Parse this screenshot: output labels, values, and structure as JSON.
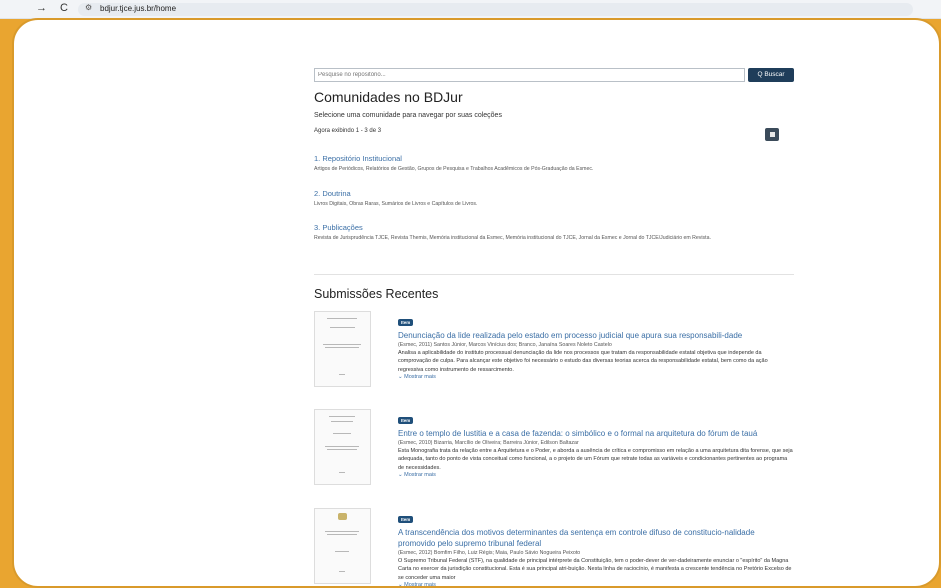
{
  "browser": {
    "url": "bdjur.tjce.jus.br/home",
    "back": "→",
    "reload": "C",
    "tune": "⚙"
  },
  "search": {
    "placeholder": "Pesquise no repositório...",
    "button": "Q Buscar"
  },
  "title": "Comunidades no BDJur",
  "subtitle": "Selecione uma comunidade para navegar por suas coleções",
  "showing": "Agora exibindo 1 - 3 de 3",
  "communities": [
    {
      "title": "1. Repositório Institucional",
      "desc": "Artigos de Periódicos, Relatórios de Gestão, Grupos de Pesquisa e Trabalhos Acadêmicos de Pós-Graduação da Esmec."
    },
    {
      "title": "2. Doutrina",
      "desc": "Livros Digitais, Obras Raras, Sumários de Livros e Capítulos de Livros."
    },
    {
      "title": "3. Publicações",
      "desc": "Revista de Jurisprudência TJCE, Revista Themis, Memória institucional da Esmec, Memória institucional do TJCE, Jornal da Esmec e Jornal do TJCE/Judiciário em Revista."
    }
  ],
  "recent_title": "Submissões Recentes",
  "items": [
    {
      "badge": "Item",
      "title": "Denunciação da lide realizada pelo estado em processo judicial que apura sua responsabili-dade",
      "authors": "(Esmec, 2011) Santos Júnior, Marcos Vinícius dos; Branco, Janaína Soares Noleto Castelo",
      "abstract": "Analisa a aplicabilidade do instituto processual denunciação da lide nos processos que tratam da responsabilidade estatal objetiva que independe da comprovação de culpa. Para alcançar este objetivo foi necessário o estudo das diversas teorias acerca da responsabilidade estatal, bem como da ação regressiva como instrumento de ressarcimento.",
      "more": "⌄ Mostrar mais"
    },
    {
      "badge": "Item",
      "title": "Entre o templo de Iustitia e a casa de fazenda: o simbólico e o formal na arquitetura do fórum de tauá",
      "authors": "(Esmec, 2010) Bizarria, Marcílio de Oliveira; Barreira Júnior, Edilson Baltazar",
      "abstract": "Esta Monografia trata da relação entre a Arquitetura e o Poder, e aborda a ausência de crítica e compromisso em relação a uma arquitetura dita forense, que seja adequada, tanto do ponto de vista conceitual como funcional, a o projeto de um Fórum que retrate todas as variáveis e condicionantes pertinentes ao programa de necessidades.",
      "more": "⌄ Mostrar mais"
    },
    {
      "badge": "Item",
      "title": "A transcendência dos motivos determinantes da sentença em controle difuso de constitucio-nalidade promovido pelo supremo tribunal federal",
      "authors": "(Esmec, 2012) Bomfim Filho, Luiz Régis; Maia, Paulo Sávio Nogueira Peixoto",
      "abstract": "O Supremo Tribunal Federal (STF), na qualidade de principal intérprete da Constituição, tem o poder-dever de ver-dadeiramente enunciar o \"espírito\" da Magna Carta no exercer da jurisdição constitucional. Esta é sua principal atri-buição. Nesta linha de raciocínio, é manifesta a crescente tendência no Pretório Excelso de se conceder uma maior",
      "more": "⌄ Mostrar mais"
    }
  ]
}
